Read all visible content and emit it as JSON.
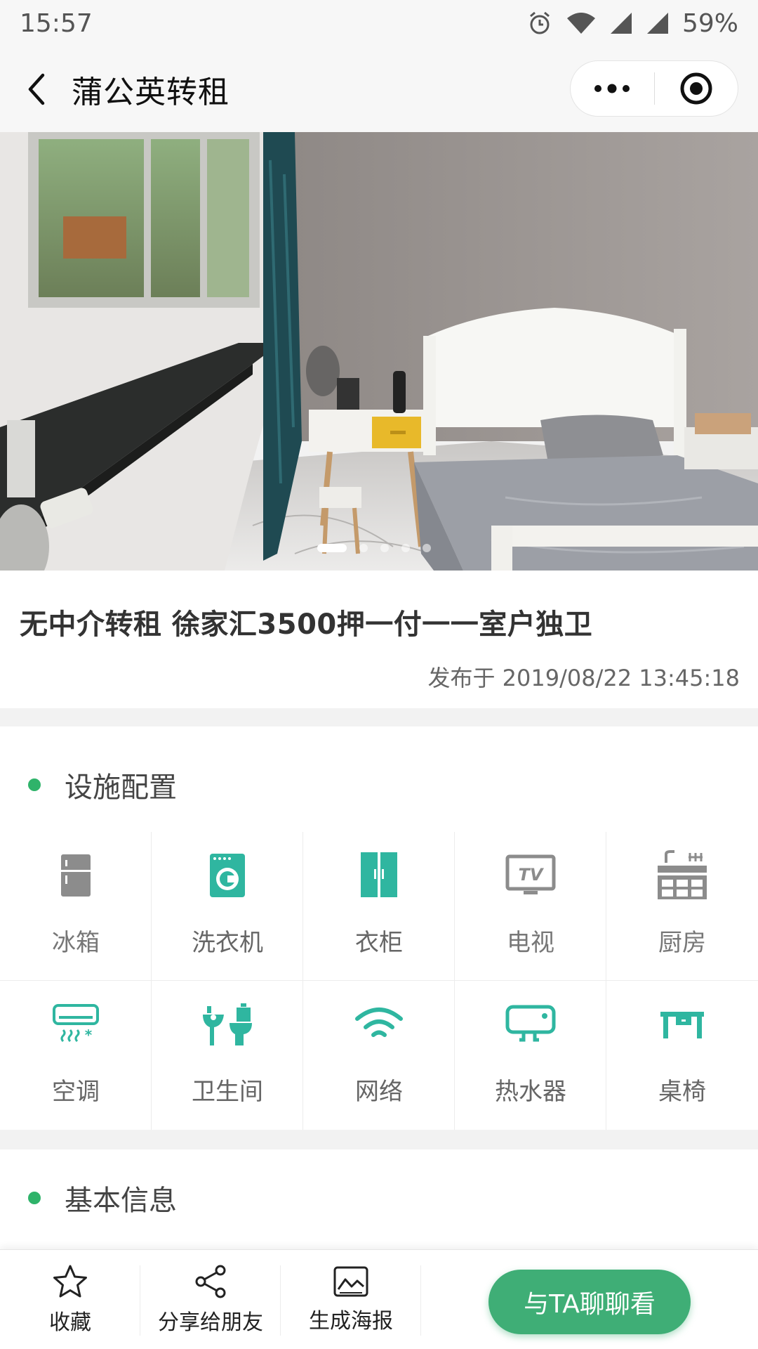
{
  "status_bar": {
    "time": "15:57",
    "battery": "59%"
  },
  "nav": {
    "title": "蒲公英转租"
  },
  "carousel": {
    "slide_count": 6,
    "active_index": 0
  },
  "listing": {
    "title": "无中介转租 徐家汇3500押一付一一室户独卫",
    "published": "发布于 2019/08/22 13:45:18"
  },
  "facilities": {
    "title": "设施配置",
    "items": [
      {
        "label": "冰箱",
        "icon": "fridge-icon",
        "available": false
      },
      {
        "label": "洗衣机",
        "icon": "washing-machine-icon",
        "available": true
      },
      {
        "label": "衣柜",
        "icon": "wardrobe-icon",
        "available": true
      },
      {
        "label": "电视",
        "icon": "tv-icon",
        "available": false
      },
      {
        "label": "厨房",
        "icon": "kitchen-icon",
        "available": false
      },
      {
        "label": "空调",
        "icon": "air-conditioner-icon",
        "available": true
      },
      {
        "label": "卫生间",
        "icon": "bathroom-icon",
        "available": true
      },
      {
        "label": "网络",
        "icon": "wifi-icon",
        "available": true
      },
      {
        "label": "热水器",
        "icon": "water-heater-icon",
        "available": true
      },
      {
        "label": "桌椅",
        "icon": "desk-chair-icon",
        "available": true
      }
    ]
  },
  "basic_info": {
    "title": "基本信息"
  },
  "bottom_bar": {
    "favorite": "收藏",
    "share": "分享给朋友",
    "poster": "生成海报",
    "chat": "与TA聊聊看"
  },
  "colors": {
    "accent": "#2fb36a",
    "button": "#3fae76",
    "icon_gray": "#8a8a8a"
  }
}
